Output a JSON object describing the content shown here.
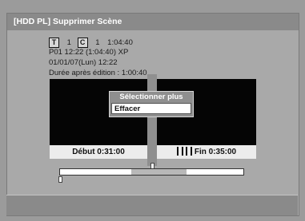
{
  "screen": {
    "title": "[HDD PL] Supprimer Scène"
  },
  "info": {
    "title_badge": "T",
    "title_number": "1",
    "chapter_badge": "C",
    "chapter_number": "1",
    "total_time": "1:04:40",
    "line2": "P01  12:22 (1:04:40) XP",
    "line3": "01/01/07(Lun)   12:22",
    "line4": "Durée après édition : 1:00:40"
  },
  "previews": {
    "start_caption": "Début  0:31:00",
    "end_caption": "Fin  0:35:00"
  },
  "popup": {
    "title": "Sélectionner plus",
    "item": "Effacer"
  },
  "timeline": {
    "selection_start_fraction": 0.39,
    "selection_end_fraction": 0.69,
    "playhead_fraction": 0.5
  },
  "colors": {
    "title_bar": "#8a8a8a",
    "background": "#a9a9a9",
    "preview": "#050505",
    "caption": "#ececec"
  }
}
